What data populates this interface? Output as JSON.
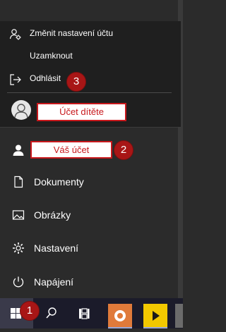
{
  "flyout": {
    "items": [
      {
        "label": "Změnit nastavení účtu",
        "icon": "account-settings-icon"
      },
      {
        "label": "Uzamknout",
        "icon": "lock-icon"
      },
      {
        "label": "Odhlásit",
        "icon": "sign-out-icon"
      }
    ],
    "child_account_label": "Účet dítěte"
  },
  "rail": {
    "account_label": "Váš účet",
    "items": [
      {
        "label": "Dokumenty",
        "icon": "document-icon"
      },
      {
        "label": "Obrázky",
        "icon": "picture-icon"
      },
      {
        "label": "Nastavení",
        "icon": "gear-icon"
      },
      {
        "label": "Napájení",
        "icon": "power-icon"
      }
    ]
  },
  "badges": {
    "one": "1",
    "two": "2",
    "three": "3"
  },
  "colors": {
    "accent_red": "#c8181c",
    "badge_red": "#a81616"
  }
}
